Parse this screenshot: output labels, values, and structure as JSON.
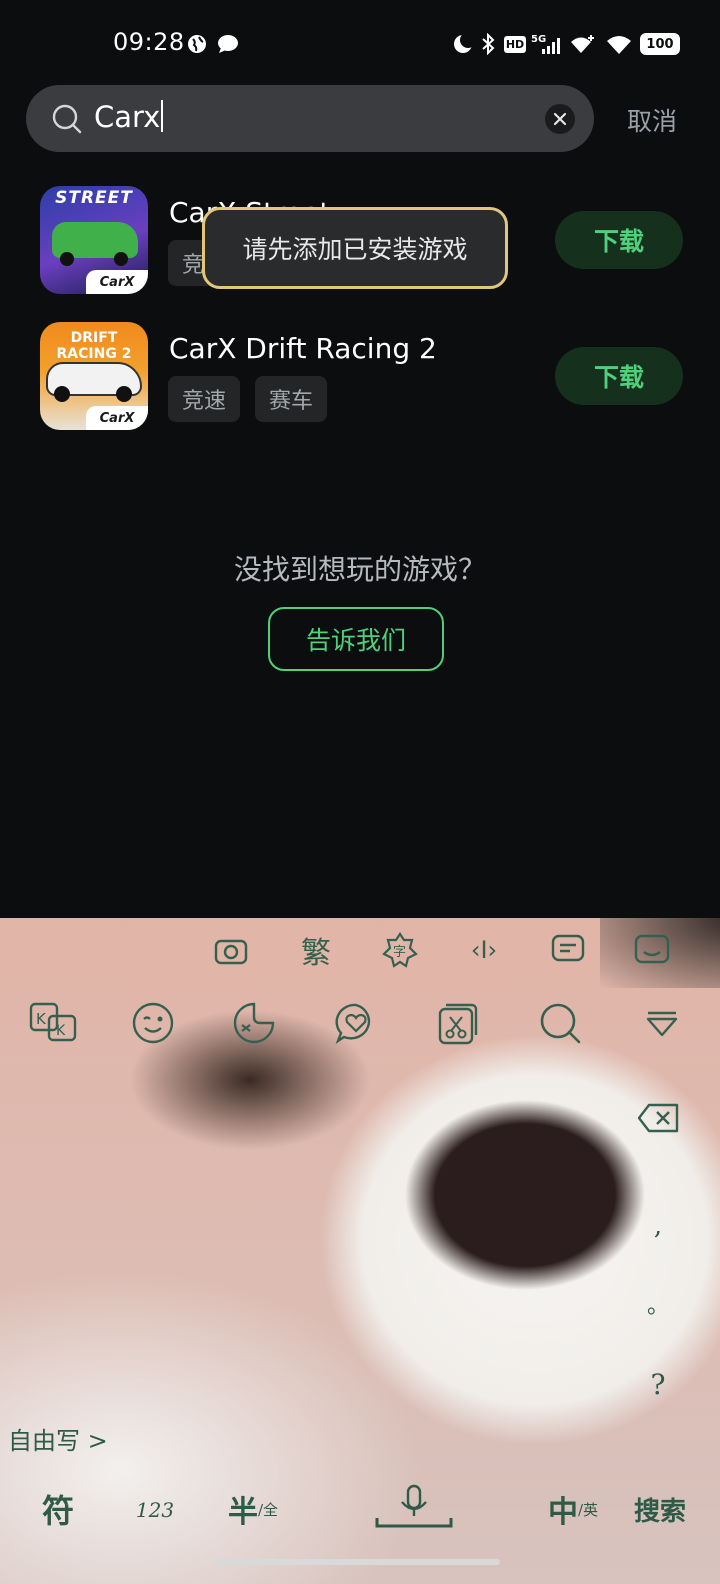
{
  "status_bar": {
    "time": "09:28",
    "battery": "100",
    "icons": [
      "earth-icon",
      "chat-bubble-icon",
      "moon-icon",
      "bluetooth-icon",
      "hd-icon",
      "5g-signal-icon",
      "wifi-plus-icon",
      "wifi-icon",
      "battery-icon"
    ],
    "hd_label": "HD",
    "net_label": "5G"
  },
  "search": {
    "query": "Carx",
    "cancel_label": "取消"
  },
  "results": [
    {
      "title": "CarX Street",
      "tags": [
        "竞速"
      ],
      "button_label": "下载",
      "icon_text": "STREET",
      "icon_brand": "CarX"
    },
    {
      "title": "CarX Drift Racing 2",
      "tags": [
        "竞速",
        "赛车"
      ],
      "button_label": "下载",
      "icon_text": "DRIFT RACING 2",
      "icon_brand": "CarX"
    }
  ],
  "toast": "请先添加已安装游戏",
  "empty_state": {
    "question": "没找到想玩的游戏？",
    "button_label": "告诉我们"
  },
  "keyboard": {
    "toolbar_top": [
      "camera-icon",
      "traditional-chinese-icon",
      "font-style-icon",
      "cursor-move-icon",
      "clipboard-text-icon",
      "keyboard-emoji-icon"
    ],
    "traditional_label": "繁",
    "cursor_label": "‹I›",
    "toolbar_icons": [
      "kk-translate-icon",
      "emoji-wink-icon",
      "sticker-icon",
      "heart-chat-icon",
      "clipboard-cut-icon",
      "search-icon",
      "collapse-keyboard-icon"
    ],
    "punctuation": [
      ",",
      "。",
      "?"
    ],
    "free_write_label": "自由写 >",
    "bottom_keys": {
      "symbols": "符",
      "numbers": "123",
      "half_full": "半",
      "half_full_sub": "/全",
      "chinese": "中",
      "english_sub": "/英",
      "search": "搜索"
    },
    "accent_color": "#2e5a48"
  },
  "colors": {
    "accent_green": "#4fd07a",
    "toast_border": "#e0c77a",
    "background": "#0b0d0f"
  }
}
